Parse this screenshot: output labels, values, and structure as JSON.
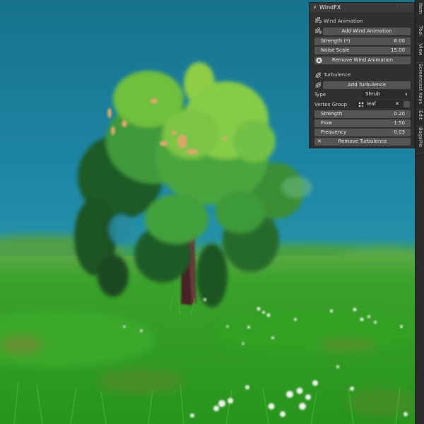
{
  "panel": {
    "title": "WindFX",
    "wind_animation": {
      "heading": "Wind Animation",
      "add_button": "Add Wind Animation",
      "strength_label": "Strength (*)",
      "strength_value": "8.00",
      "noise_scale_label": "Noise Scale",
      "noise_scale_value": "15.00",
      "remove_button": "Remove Wind Animation"
    },
    "turbulence": {
      "heading": "Turbulence",
      "add_button": "Add Turbulence",
      "type_label": "Type",
      "type_value": "Shrub",
      "vertex_group_label": "Vertex Group",
      "vertex_group_value": "leaf",
      "strength_label": "Strength",
      "strength_value": "0.20",
      "flow_label": "Flow",
      "flow_value": "1.50",
      "frequency_label": "Frequency",
      "frequency_value": "0.03",
      "remove_button": "Remove Turbulence"
    }
  },
  "tabs": [
    "Item",
    "Tool",
    "View",
    "Screencast Keys",
    "Edit",
    "BagaPie"
  ],
  "colors": {
    "sky": "#1d86a4",
    "grass": "#2e9a26",
    "panel_bg": "#303030",
    "button_bg": "#545454"
  }
}
